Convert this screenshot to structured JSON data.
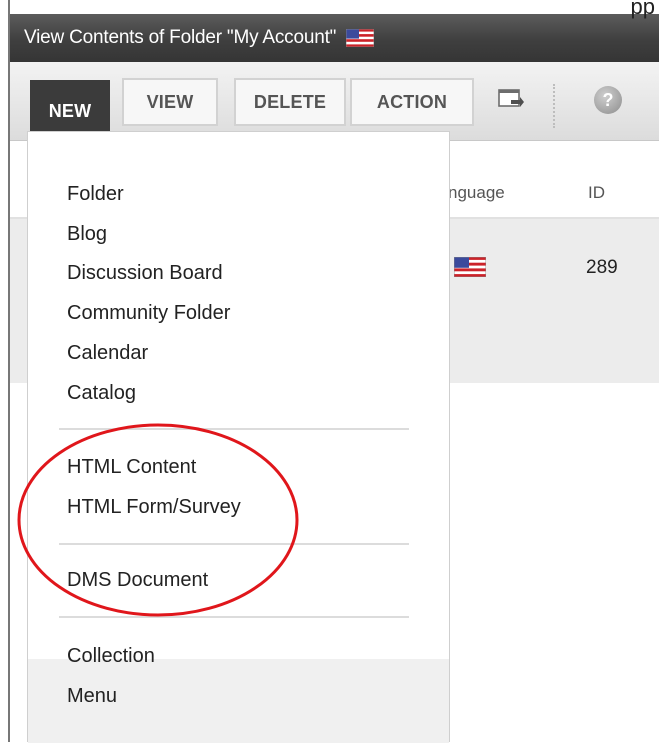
{
  "window": {
    "title": "View Contents of Folder \"My Account\"",
    "corner_fragment": "pp"
  },
  "toolbar": {
    "new_label": "NEW",
    "view_label": "VIEW",
    "delete_label": "DELETE",
    "action_label": "ACTION",
    "icons": {
      "export": "window-export-icon",
      "help": "help-icon"
    }
  },
  "table": {
    "columns": [
      "nguage",
      "ID"
    ],
    "rows": [
      {
        "language": "en-US",
        "id": "289"
      }
    ]
  },
  "new_menu": {
    "groups": [
      [
        "Folder",
        "Blog",
        "Discussion Board",
        "Community Folder",
        "Calendar",
        "Catalog"
      ],
      [
        "HTML Content",
        "HTML Form/Survey"
      ],
      [
        "DMS Document"
      ],
      [
        "Collection",
        "Menu"
      ]
    ]
  },
  "colors": {
    "title_bar": "#3f3f3f",
    "active_button": "#3b3b3b",
    "annotation": "#e0161b",
    "row_background": "#ececec"
  }
}
